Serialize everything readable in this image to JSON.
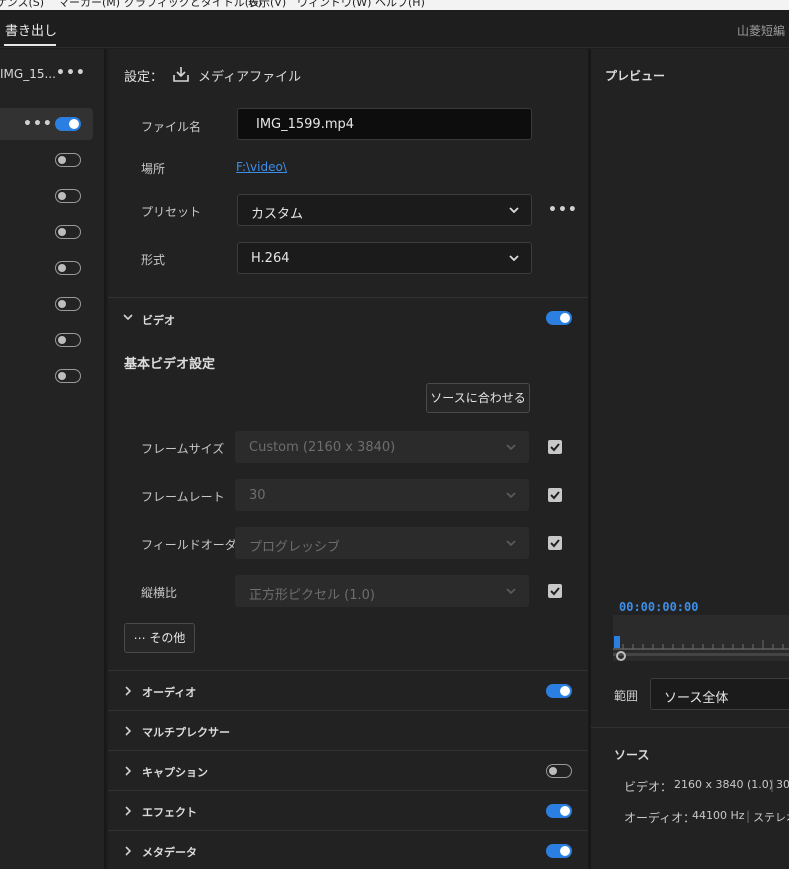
{
  "menubar": [
    "ケンス(S)",
    "マーカー(M)",
    "グラフィックとタイトル(G)",
    "表示(V)",
    "ウィンドウ(W)",
    "ヘルプ(H)"
  ],
  "tabs": {
    "export": "書き出し",
    "right": "山菱短編"
  },
  "queue": {
    "title": "IMG_15...",
    "toggles": [
      true,
      false,
      false,
      false,
      false,
      false,
      false,
      false
    ]
  },
  "settings": {
    "header_label": "設定：",
    "header_dest": "メディアファイル",
    "filename_label": "ファイル名",
    "filename_value": "IMG_1599.mp4",
    "location_label": "場所",
    "location_value": "F:\\video\\",
    "preset_label": "プリセット",
    "preset_value": "カスタム",
    "format_label": "形式",
    "format_value": "H.264"
  },
  "video": {
    "section_title": "ビデオ",
    "enabled": true,
    "basic_title": "基本ビデオ設定",
    "match_source_button": "ソースに合わせる",
    "rows": [
      {
        "label": "フレームサイズ",
        "value": "Custom (2160 x 3840)",
        "checked": true
      },
      {
        "label": "フレームレート",
        "value": "30",
        "checked": true
      },
      {
        "label": "フィールドオーダー",
        "value": "プログレッシブ",
        "checked": true
      },
      {
        "label": "縦横比",
        "value": "正方形ピクセル (1.0)",
        "checked": true
      }
    ],
    "more_button": "その他"
  },
  "sections": [
    {
      "title": "オーディオ",
      "toggle": "on"
    },
    {
      "title": "マルチプレクサー",
      "toggle": "none"
    },
    {
      "title": "キャプション",
      "toggle": "off"
    },
    {
      "title": "エフェクト",
      "toggle": "on"
    },
    {
      "title": "メタデータ",
      "toggle": "on"
    }
  ],
  "preview": {
    "title": "プレビュー",
    "timecode": "00:00:00:00",
    "range_label": "範囲",
    "range_value": "ソース全体",
    "source_title": "ソース",
    "video_label": "ビデオ：",
    "video_value": "2160 x 3840 (1.0)",
    "video_extra": "30",
    "audio_label": "オーディオ：",
    "audio_value": "44100 Hz",
    "audio_extra": "ステレオ"
  },
  "colors": {
    "accent": "#2a7fe0",
    "timecode": "#3d8ee8"
  }
}
